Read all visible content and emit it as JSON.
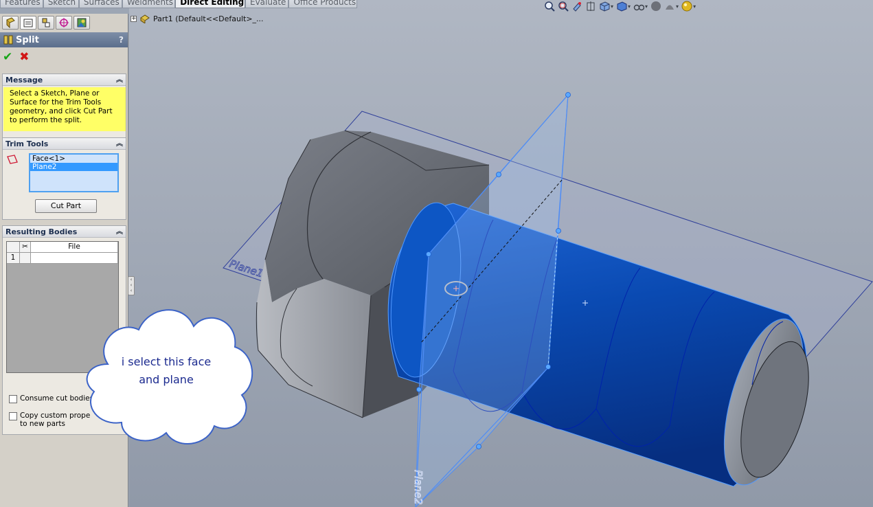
{
  "command_tabs": [
    "Features",
    "Sketch",
    "Surfaces",
    "Weldments",
    "Direct Editing",
    "Evaluate",
    "Office Products"
  ],
  "active_command_tab": "Direct Editing",
  "view_toolbar": {
    "icons": [
      "zoom-to-fit-icon",
      "zoom-to-area-icon",
      "previous-view-icon",
      "section-view-icon",
      "view-orientation-icon",
      "display-style-icon",
      "hide-show-items-icon",
      "edit-appearance-icon",
      "apply-scene-icon",
      "view-settings-icon"
    ]
  },
  "feature_tree": {
    "expand": "+",
    "label": "Part1  (Default<<Default>_..."
  },
  "property_manager": {
    "title": "Split",
    "help": "?",
    "message": {
      "title": "Message",
      "text": "Select a Sketch, Plane or Surface for the Trim Tools geometry, and click Cut Part to perform the split."
    },
    "trim_tools": {
      "title": "Trim Tools",
      "items": [
        "Face<1>",
        "Plane2"
      ],
      "selected_index": 1,
      "cut_button": "Cut Part"
    },
    "resulting_bodies": {
      "title": "Resulting Bodies",
      "columns": [
        "",
        "File"
      ],
      "rows": [
        {
          "num": "1",
          "file": ""
        }
      ]
    },
    "options": {
      "consume_cut_bodies": "Consume cut bodies",
      "copy_custom_properties_line1": "Copy custom prope",
      "copy_custom_properties_line2": "to new parts"
    }
  },
  "graphics": {
    "plane1_label": "Plane1",
    "plane2_label": "Plane2"
  },
  "callout": {
    "line1": "i select this face",
    "line2": "and plane"
  },
  "colors": {
    "background": "#9da6b4",
    "cylinder_face": "#0a4fb8",
    "plane_edge": "#2f3f9a",
    "selection_blue": "#3399ff",
    "message_yellow": "#ffff66"
  }
}
